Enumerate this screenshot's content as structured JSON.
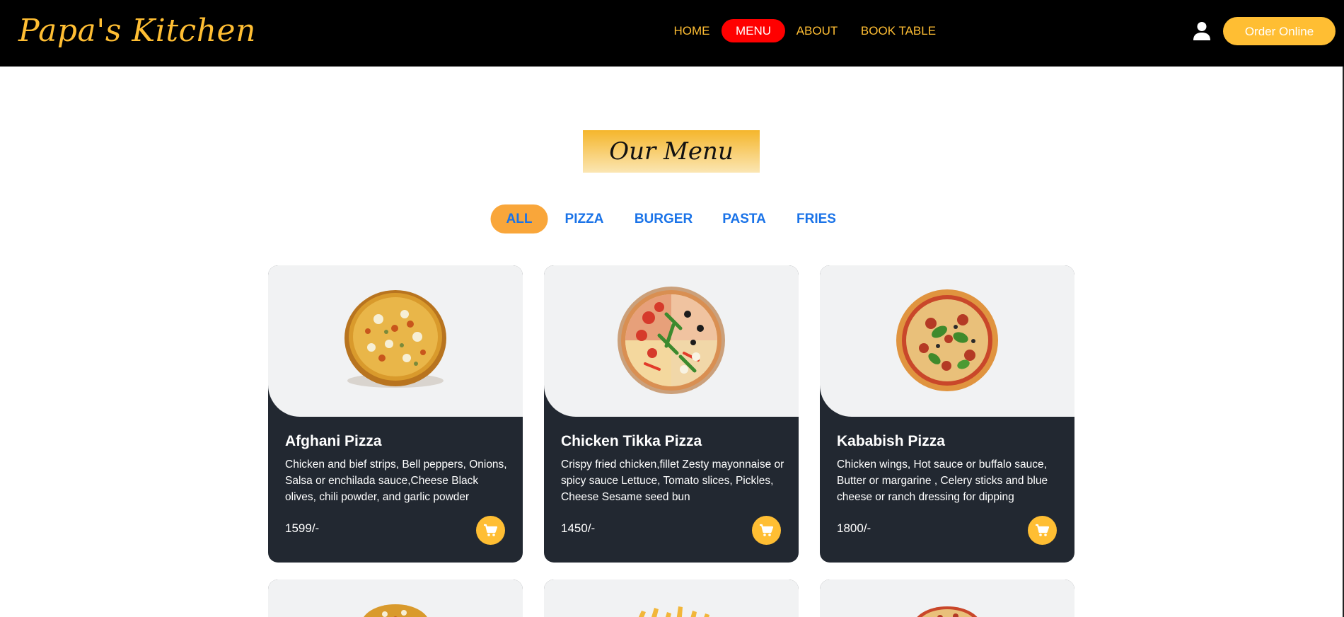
{
  "brand": {
    "name": "Papa's Kitchen"
  },
  "nav": {
    "items": [
      {
        "label": "HOME",
        "active": false
      },
      {
        "label": "MENU",
        "active": true
      },
      {
        "label": "ABOUT",
        "active": false
      },
      {
        "label": "BOOK TABLE",
        "active": false
      }
    ],
    "order_label": "Order Online"
  },
  "section": {
    "heading": "Our Menu"
  },
  "filters": [
    {
      "label": "ALL",
      "active": true
    },
    {
      "label": "PIZZA",
      "active": false
    },
    {
      "label": "BURGER",
      "active": false
    },
    {
      "label": "PASTA",
      "active": false
    },
    {
      "label": "FRIES",
      "active": false
    }
  ],
  "menu_items": [
    {
      "name": "Afghani Pizza",
      "description": "Chicken and bief strips, Bell peppers, Onions, Salsa or enchilada sauce,Cheese Black olives, chili powder, and garlic powder",
      "price": "1599/-",
      "icon": "afghani-pizza-image"
    },
    {
      "name": "Chicken Tikka Pizza",
      "description": "Crispy fried chicken,fillet Zesty mayonnaise or spicy sauce Lettuce, Tomato slices, Pickles, Cheese Sesame seed bun",
      "price": "1450/-",
      "icon": "chicken-tikka-pizza-image"
    },
    {
      "name": "Kababish Pizza",
      "description": "Chicken wings, Hot sauce or buffalo sauce, Butter or margarine , Celery sticks and blue cheese or ranch dressing for dipping",
      "price": "1800/-",
      "icon": "kababish-pizza-image"
    }
  ],
  "colors": {
    "accent": "#ffbe33",
    "nav_active": "#ff0000",
    "filter_active": "#f9a63a",
    "filter_text": "#1a73e8",
    "card_dark": "#222831",
    "card_light": "#f1f2f3"
  }
}
